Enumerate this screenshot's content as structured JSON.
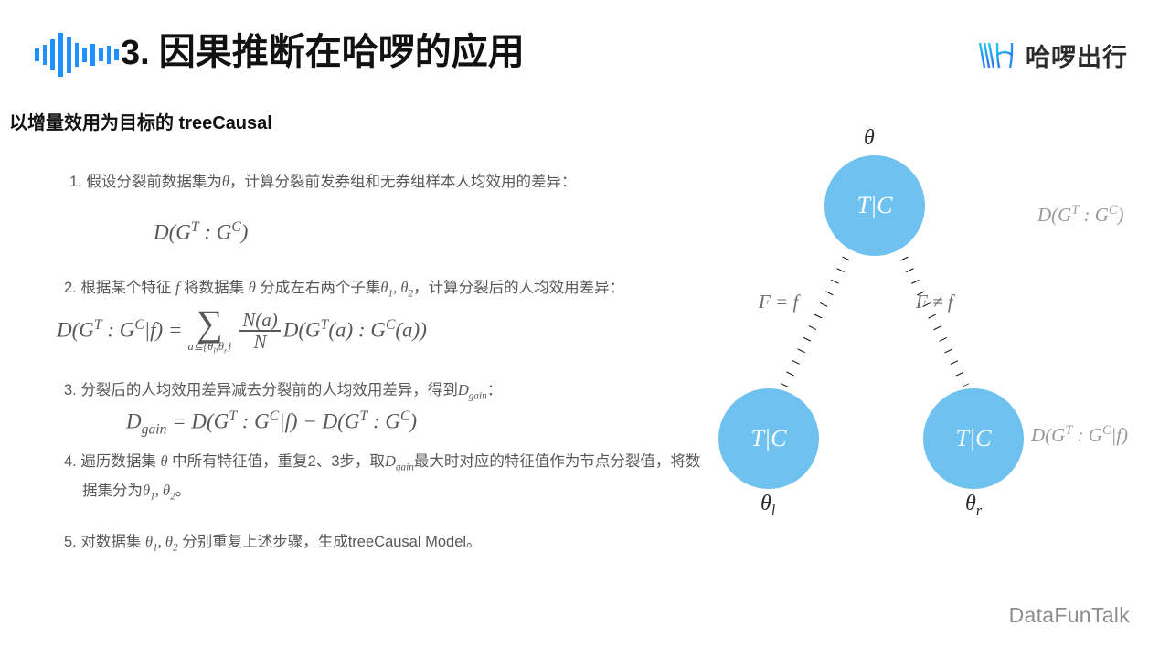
{
  "header": {
    "title_number": "3.",
    "title_text": "因果推断在哈啰的应用",
    "wave_icon": "audio-waveform-icon",
    "wave_bars": [
      14,
      22,
      34,
      48,
      40,
      26,
      16,
      24,
      14,
      20,
      12
    ],
    "brand": {
      "mark": "hello-h-logo-icon",
      "text": "哈啰出行"
    }
  },
  "subtitle": "以增量效用为目标的 treeCausal",
  "steps": [
    {
      "index": "1.",
      "text_html": "假设分裂前数据集为<span class=\"mi\">θ</span>，计算分裂前发券组和无券组样本人均效用的差异："
    },
    {
      "index": "2.",
      "text_html": "根据某个特征 <span class=\"mi\">f</span> 将数据集 <span class=\"mi\">θ</span> 分成左右两个子集<span class=\"mi\">θ<sub class=\"sm\">1</sub>, θ<sub class=\"sm\">2</sub></span>，计算分裂后的人均效用差异："
    },
    {
      "index": "3.",
      "text_html": "分裂后的人均效用差异减去分裂前的人均效用差异，得到<span class=\"mi\">D<sub class=\"sm\">gain</sub></span>："
    },
    {
      "index": "4.",
      "text_html": "遍历数据集 <span class=\"mi\">θ</span> 中所有特征值，重复2、3步，取<span class=\"mi\">D<sub class=\"sm\">gain</sub></span>最大时对应的特征值作为节点分裂值，将数据集分为<span class=\"mi\">θ<sub class=\"sm\">1</sub>, θ<sub class=\"sm\">2</sub></span>。"
    },
    {
      "index": "5.",
      "text_html": "对数据集 <span class=\"mi\">θ<sub class=\"sm\">1</sub>, θ<sub class=\"sm\">2</sub></span> 分别重复上述步骤，生成treeCausal Model。"
    }
  ],
  "formulas": {
    "f1_html": "D(G<sup class=\"sm\">T</sup> : G<sup class=\"sm\">C</sup>)",
    "f2_lhs_html": "D(G<sup class=\"sm\">T</sup> : G<sup class=\"sm\">C</sup>|f) =",
    "f2_sum_symbol": "∑",
    "f2_sum_sub_html": "a⊆{θ<sub class=\"sm\">l</sub>,θ<sub class=\"sm\">r</sub>}",
    "f2_frac_num_html": "N(a)",
    "f2_frac_den_html": "N",
    "f2_rhs_html": "D(G<sup class=\"sm\">T</sup>(a) : G<sup class=\"sm\">C</sup>(a))",
    "f3_html": "D<sub class=\"sm\">gain</sub> = D(G<sup class=\"sm\">T</sup> : G<sup class=\"sm\">C</sup>|f) − D(G<sup class=\"sm\">T</sup> : G<sup class=\"sm\">C</sup>)"
  },
  "tree": {
    "node_label_text": "T|C",
    "root_theta": "θ",
    "left_theta_html": "θ<sub class=\"sm\">l</sub>",
    "right_theta_html": "θ<sub class=\"sm\">r</sub>",
    "edge_left_label": "F = f",
    "edge_right_label": "F ≠ f",
    "side_formula_root_html": "D(G<sup class=\"sm\">T</sup> : G<sup class=\"sm\">C</sup>)",
    "side_formula_child_html": "D(G<sup class=\"sm\">T</sup> : G<sup class=\"sm\">C</sup>|f)",
    "node_color": "#6FC2EF",
    "edge_style": "dotted"
  },
  "watermark": "DataFunTalk",
  "colors": {
    "accent_blue": "#1E90FF",
    "node_blue": "#6FC2EF",
    "body_gray": "#58585a",
    "muted_gray": "#9a9a9c"
  }
}
